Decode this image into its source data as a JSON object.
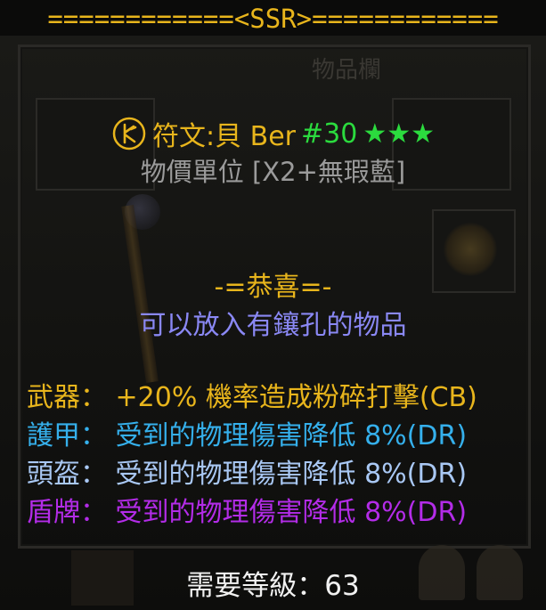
{
  "header": {
    "text": "============<SSR>============"
  },
  "item": {
    "name_prefix": "符文:貝 Ber",
    "number": "#30",
    "stars": "★★★",
    "price_line": "物價單位 [X2+無瑕藍]"
  },
  "info": {
    "congrats": "-=恭喜=-",
    "socket_text": "可以放入有鑲孔的物品"
  },
  "stats": [
    {
      "label": "武器：",
      "value": " +20% 機率造成粉碎打擊(CB)",
      "color": "#e8b51c"
    },
    {
      "label": "護甲：",
      "value": " 受到的物理傷害降低 8%(DR)",
      "color": "#35b0ec"
    },
    {
      "label": "頭盔：",
      "value": " 受到的物理傷害降低 8%(DR)",
      "color": "#a9c8f4"
    },
    {
      "label": "盾牌：",
      "value": " 受到的物理傷害降低 8%(DR)",
      "color": "#b32ce8"
    }
  ],
  "requirement": {
    "label": "需要等級：",
    "value": "63"
  },
  "background": {
    "panel_title": "物品欄"
  },
  "icons": {
    "rune": "rune-ber-icon"
  }
}
